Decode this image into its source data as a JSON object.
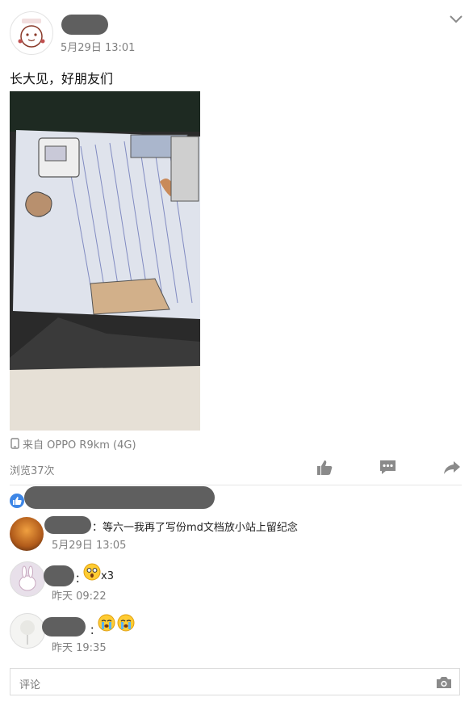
{
  "post": {
    "date": "5月29日 13:01",
    "text": "长大见，好朋友们",
    "device": "来自 OPPO R9km (4G)",
    "views": "浏览37次"
  },
  "comments": [
    {
      "text": "：等六一我再了写份md文档放小站上留纪念",
      "time": "5月29日 13:05"
    },
    {
      "text": "：",
      "suffix": "x3",
      "time": "昨天 09:22"
    },
    {
      "text": "：",
      "time": "昨天 19:35"
    }
  ],
  "comment_box": {
    "placeholder": "评论"
  },
  "colors": {
    "like_badge": "#3d86e6",
    "icon_gray": "#8a8a8a",
    "divider": "#e6e6e6"
  },
  "icons": [
    "chevron-down-icon",
    "phone-icon",
    "like-icon",
    "comment-icon",
    "share-icon",
    "camera-icon",
    "thumb-badge-icon",
    "emoji-shocked-icon",
    "emoji-crying-icon"
  ]
}
